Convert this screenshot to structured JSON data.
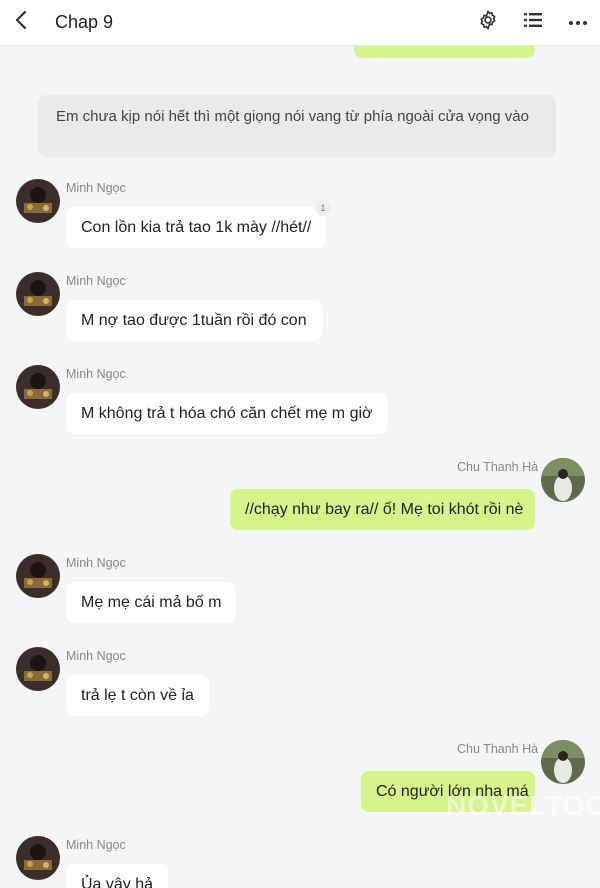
{
  "header": {
    "title": "Chap 9"
  },
  "narration": "Em chưa kịp nói hết thì một giọng nói vang từ phía ngoài cửa vọng vào",
  "messages": [
    {
      "sender": "Minh Ngọc",
      "text": "Con lồn kia trả tao 1k mày //hét//",
      "side": "left",
      "badge": "1"
    },
    {
      "sender": "Minh Ngọc",
      "text": "M nợ tao được 1tuần rồi đó con",
      "side": "left"
    },
    {
      "sender": "Minh Ngọc",
      "text": "M không trả t hóa chó căn chết mẹ m giờ",
      "side": "left"
    },
    {
      "sender": "Chu Thanh Hà",
      "text": "//chạy như bay ra// ố! Mẹ toi khót rồi nè",
      "side": "right"
    },
    {
      "sender": "Minh Ngọc",
      "text": "Mẹ mẹ cái mả bố m",
      "side": "left"
    },
    {
      "sender": "Minh Ngọc",
      "text": "trả lẹ t còn về ỉa",
      "side": "left"
    },
    {
      "sender": "Chu Thanh Hà",
      "text": "Có người lớn nha má",
      "side": "right"
    },
    {
      "sender": "Minh Ngọc",
      "text": "Ủa vậy hả",
      "side": "left"
    }
  ],
  "watermark": "NOVELTOON",
  "icons": {
    "back": "chevron-left-icon",
    "settings": "gear-icon",
    "list": "list-icon",
    "more": "more-dots-icon"
  },
  "colors": {
    "right_bubble": "#d5f48a",
    "left_bubble": "#ffffff",
    "narration_bg": "#e9eaeb",
    "background": "#f4f5f6"
  }
}
